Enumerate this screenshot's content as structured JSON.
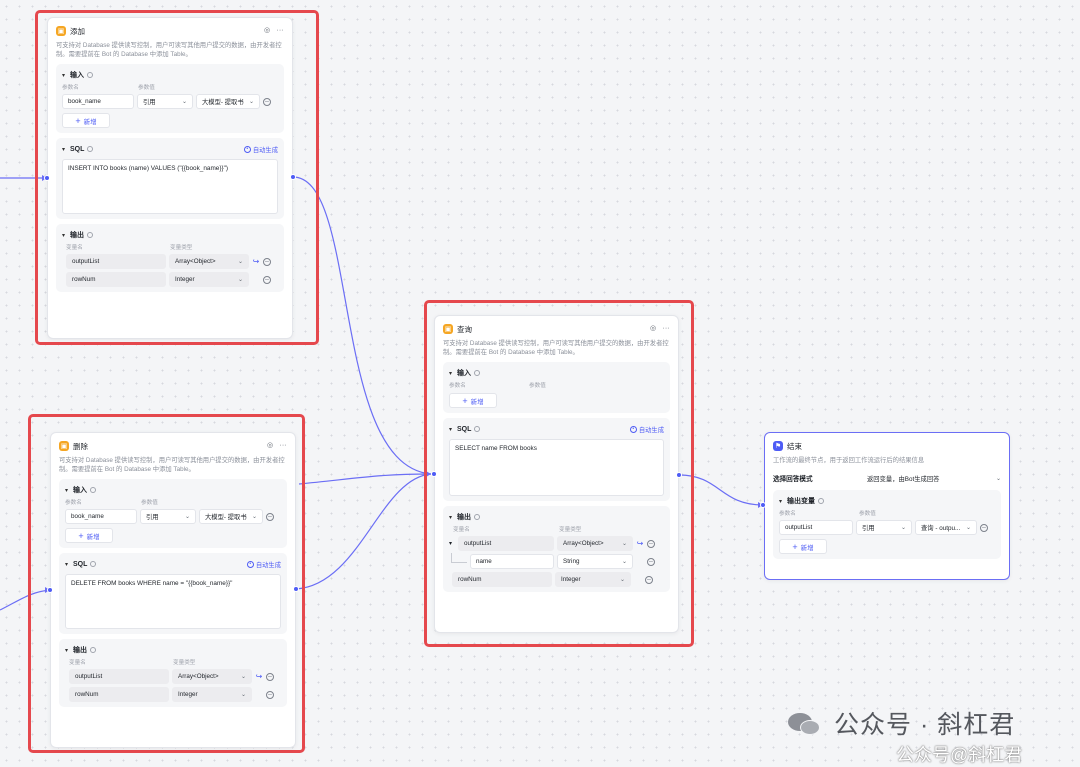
{
  "colors": {
    "accent": "#4e5cf5",
    "highlight": "#e5484d",
    "db_icon": "#f5a623"
  },
  "desc_db": "可支持对 Database 提供读写控制，用户可读写其他用户提交的数据，由开发者控制。需要提前在 Bot 的 Database 中添加 Table。",
  "labels": {
    "input": "输入",
    "output": "输出",
    "sql": "SQL",
    "param_name": "参数名",
    "param_value": "参数值",
    "var_name": "变量名",
    "var_type": "变量类型",
    "add": "新增",
    "autogen": "自动生成"
  },
  "node_add": {
    "title": "添加",
    "inputs": [
      {
        "name": "book_name",
        "mode": "引用",
        "value": "大模型- 提取书"
      }
    ],
    "sql": "INSERT INTO books (name) VALUES (\"{{book_name}}\")",
    "outputs": [
      {
        "name": "outputList",
        "type": "Array<Object>"
      },
      {
        "name": "rowNum",
        "type": "Integer"
      }
    ]
  },
  "node_delete": {
    "title": "删除",
    "inputs": [
      {
        "name": "book_name",
        "mode": "引用",
        "value": "大模型- 提取书"
      }
    ],
    "sql": "DELETE FROM books WHERE name = \"{{book_name}}\"",
    "outputs": [
      {
        "name": "outputList",
        "type": "Array<Object>"
      },
      {
        "name": "rowNum",
        "type": "Integer"
      }
    ]
  },
  "node_query": {
    "title": "查询",
    "sql": "SELECT name FROM books",
    "outputs": [
      {
        "name": "outputList",
        "type": "Array<Object>"
      },
      {
        "name": "name",
        "type": "String"
      },
      {
        "name": "rowNum",
        "type": "Integer"
      }
    ]
  },
  "node_end": {
    "title": "结束",
    "desc": "工作流的最终节点，用于返回工作流运行后的结果信息",
    "mode_label": "选择回答模式",
    "mode_value": "返回变量，由Bot生成回答",
    "output_title": "输出变量",
    "vars": [
      {
        "name": "outputList",
        "mode": "引用",
        "value": "查询 - outpu..."
      }
    ]
  },
  "watermark": {
    "main": "公众号 · 斜杠君",
    "sub": "公众号@斜杠君"
  }
}
